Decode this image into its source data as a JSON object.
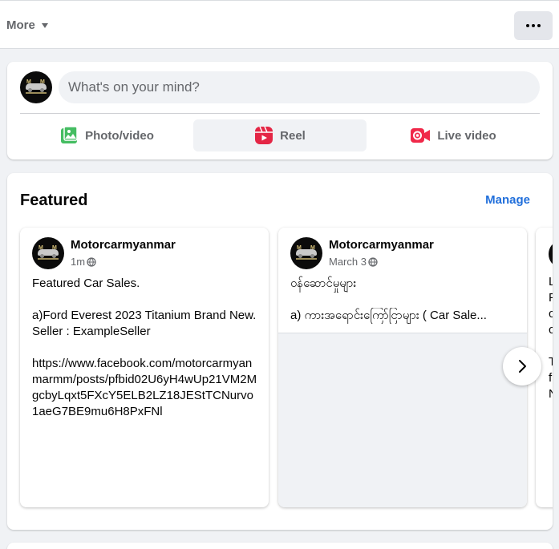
{
  "topbar": {
    "more_label": "More"
  },
  "composer": {
    "placeholder": "What's on your mind?",
    "actions": [
      {
        "label": "Photo/video",
        "icon": "photo-video-icon",
        "color": "#45bd62"
      },
      {
        "label": "Reel",
        "icon": "reel-icon",
        "color": "#e42645"
      },
      {
        "label": "Live video",
        "icon": "live-video-icon",
        "color": "#f02849"
      }
    ]
  },
  "featured": {
    "title": "Featured",
    "manage_label": "Manage",
    "posts": [
      {
        "author": "Motorcarmyanmar",
        "time": "1m",
        "body": "Featured Car Sales.\n\na)Ford Everest 2023 Titanium Brand New.\nSeller : ExampleSeller\n\nhttps://www.facebook.com/motorcarmyanmarmm/posts/pfbid02U6yH4wUp21VM2MgcbyLqxt5FXcY5ELB2LZ18JEStTCNurvo1aeG7BE9mu6H8PxFNl"
      },
      {
        "author": "Motorcarmyanmar",
        "time": "March 3",
        "line1": "ဝန်ဆောင်မှုများ",
        "line2": "a) ကားအရောင်းကြော်ငြာများ ( Car Sale..."
      }
    ],
    "peek_lines": [
      "L",
      "F",
      "c",
      "c",
      "",
      "T",
      "f",
      "N"
    ]
  },
  "colors": {
    "accent": "#216fdb",
    "secondary_text": "#65676b"
  }
}
